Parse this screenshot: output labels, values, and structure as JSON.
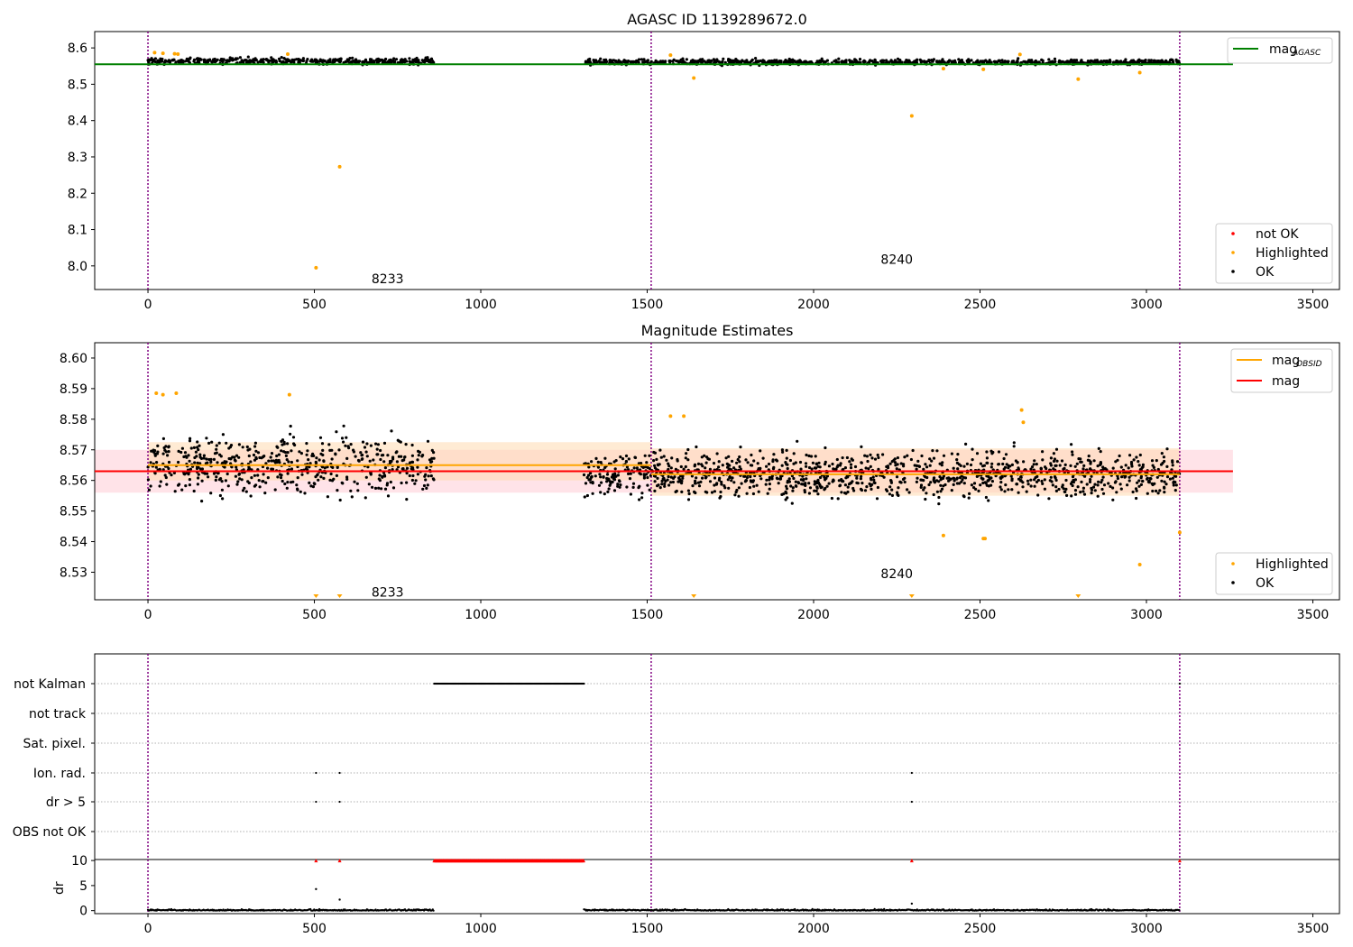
{
  "figure": {
    "title": "AGASC ID 1139289672.0"
  },
  "colors": {
    "ok": "#000000",
    "highlighted": "#ffa500",
    "not_ok": "#ff0000",
    "mag_agasc": "#008000",
    "mag_obsid": "#ffa500",
    "mag": "#ff0000",
    "obsid_sep": "#800080",
    "band_red": "#ffc0cb",
    "band_orange": "#ffdab0",
    "grid": "#b0b0b0"
  },
  "chart_data": [
    {
      "id": "top",
      "type": "scatter",
      "title": "",
      "xlim": [
        -160,
        3580
      ],
      "ylim": [
        7.935,
        8.645
      ],
      "xticks": [
        0,
        500,
        1000,
        1500,
        2000,
        2500,
        3000,
        3500
      ],
      "yticks": [
        8.0,
        8.1,
        8.2,
        8.3,
        8.4,
        8.5,
        8.6
      ],
      "ytick_labels": [
        "8.0",
        "8.1",
        "8.2",
        "8.3",
        "8.4",
        "8.5",
        "8.6"
      ],
      "obsid_boundaries": [
        0,
        1512,
        3100
      ],
      "obsid_labels": [
        {
          "text": "8233",
          "x": 720,
          "y": 7.965
        },
        {
          "text": "8240",
          "x": 2250,
          "y": 8.018
        }
      ],
      "mag_agasc": {
        "value": 8.555,
        "x": [
          -160,
          3260
        ]
      },
      "ok_series": {
        "segments": [
          {
            "x0": 0,
            "x1": 860,
            "mean": 8.564,
            "spread": 0.007,
            "n": 420
          },
          {
            "x0": 1310,
            "x1": 3100,
            "mean": 8.561,
            "spread": 0.006,
            "n": 880
          }
        ]
      },
      "highlighted": {
        "x": [
          20,
          45,
          80,
          90,
          420,
          505,
          576,
          1570,
          1640,
          2295,
          2390,
          2510,
          2620,
          2795,
          2980
        ],
        "y": [
          8.587,
          8.585,
          8.584,
          8.583,
          8.583,
          7.995,
          8.273,
          8.58,
          8.517,
          8.413,
          8.543,
          8.541,
          8.582,
          8.514,
          8.532
        ]
      },
      "legend_top": {
        "entries": [
          {
            "label": "mag",
            "subscript": "AGASC",
            "color": "#008000"
          }
        ]
      },
      "legend_bottom": {
        "entries": [
          {
            "label": "not OK",
            "color": "#ff0000"
          },
          {
            "label": "Highlighted",
            "color": "#ffa500"
          },
          {
            "label": "OK",
            "color": "#000000"
          }
        ]
      }
    },
    {
      "id": "middle",
      "type": "scatter",
      "title": "Magnitude Estimates",
      "xlim": [
        -160,
        3580
      ],
      "ylim": [
        8.521,
        8.605
      ],
      "xticks": [
        0,
        500,
        1000,
        1500,
        2000,
        2500,
        3000,
        3500
      ],
      "yticks": [
        8.53,
        8.54,
        8.55,
        8.56,
        8.57,
        8.58,
        8.59,
        8.6
      ],
      "ytick_labels": [
        "8.53",
        "8.54",
        "8.55",
        "8.56",
        "8.57",
        "8.58",
        "8.59",
        "8.60"
      ],
      "obsid_boundaries": [
        0,
        1512,
        3100
      ],
      "obsid_labels": [
        {
          "text": "8233",
          "x": 720,
          "y": 8.5235
        },
        {
          "text": "8240",
          "x": 2250,
          "y": 8.5295
        }
      ],
      "mag": {
        "value": 8.563,
        "band": [
          8.556,
          8.57
        ],
        "x": [
          -160,
          3260
        ]
      },
      "mag_obsid": [
        {
          "value": 8.565,
          "band": [
            8.56,
            8.5725
          ],
          "x": [
            0,
            1512
          ]
        },
        {
          "value": 8.562,
          "band": [
            8.555,
            8.5705
          ],
          "x": [
            1512,
            3100
          ]
        }
      ],
      "ok_series": {
        "segments": [
          {
            "x0": 0,
            "x1": 860,
            "mean": 8.565,
            "spread": 0.0075,
            "n": 560
          },
          {
            "x0": 1310,
            "x1": 3100,
            "mean": 8.562,
            "spread": 0.006,
            "n": 1250
          }
        ]
      },
      "highlighted": {
        "x": [
          25,
          45,
          85,
          425,
          1570,
          1610,
          2390,
          2510,
          2515,
          2625,
          2630,
          2980,
          3100
        ],
        "y": [
          8.5885,
          8.588,
          8.5885,
          8.588,
          8.581,
          8.581,
          8.542,
          8.541,
          8.541,
          8.583,
          8.579,
          8.5325,
          8.543
        ]
      },
      "below_range_markers": {
        "x": [
          505,
          576,
          1640,
          2295,
          2795
        ]
      },
      "legend_top": {
        "entries": [
          {
            "label": "mag",
            "subscript": "OBSID",
            "color": "#ffa500"
          },
          {
            "label": "mag",
            "subscript": "",
            "color": "#ff0000"
          }
        ]
      },
      "legend_bottom": {
        "entries": [
          {
            "label": "Highlighted",
            "color": "#ffa500"
          },
          {
            "label": "OK",
            "color": "#000000"
          }
        ]
      }
    },
    {
      "id": "flags",
      "type": "scatter",
      "title": "",
      "xlim": [
        -160,
        3580
      ],
      "categories": [
        "not Kalman",
        "not track",
        "Sat. pixel.",
        "Ion. rad.",
        "dr > 5",
        "OBS not OK"
      ],
      "obsid_boundaries": [
        0,
        1512,
        3100
      ],
      "flag_points": {
        "not Kalman": {
          "ranges": [
            [
              860,
              1310
            ]
          ],
          "x": [
            3100
          ]
        },
        "Ion. rad.": {
          "x": [
            505,
            576,
            2295
          ]
        },
        "dr > 5": {
          "x": [
            505,
            576,
            2295
          ]
        }
      }
    },
    {
      "id": "dr",
      "type": "scatter",
      "title": "",
      "xlim": [
        -160,
        3580
      ],
      "ylim": [
        -0.6,
        10.2
      ],
      "ylabel": "dr",
      "xticks": [
        0,
        500,
        1000,
        1500,
        2000,
        2500,
        3000,
        3500
      ],
      "yticks": [
        0,
        5,
        10
      ],
      "obsid_boundaries": [
        0,
        1512,
        3100
      ],
      "dr_values": {
        "segments": [
          {
            "x0": 0,
            "x1": 860
          },
          {
            "x0": 1310,
            "x1": 3100
          }
        ],
        "spikes": {
          "x": [
            505,
            576,
            2295
          ],
          "y": [
            4.3,
            2.2,
            1.4
          ]
        }
      },
      "capped_at_10": {
        "ranges": [
          [
            860,
            1310
          ]
        ],
        "x": [
          505,
          576,
          2295,
          3100
        ]
      }
    }
  ]
}
